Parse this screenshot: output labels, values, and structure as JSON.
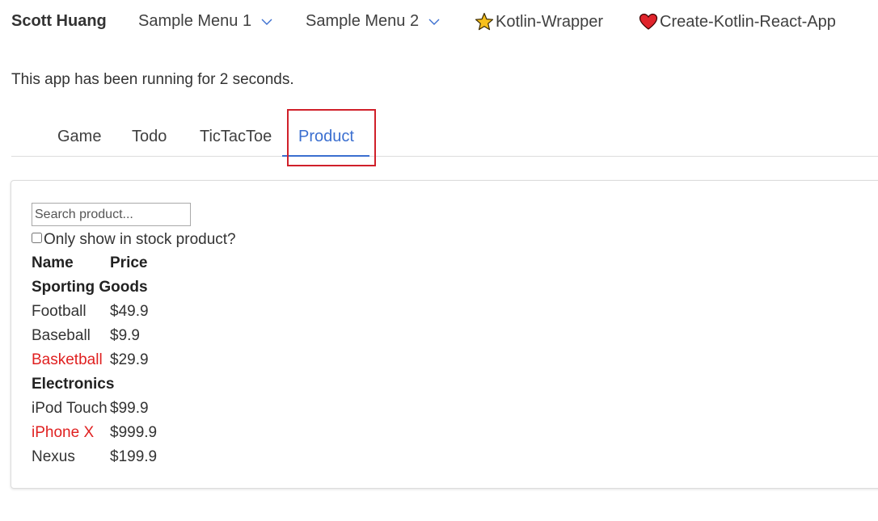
{
  "nav": {
    "brand": "Scott Huang",
    "menu1": "Sample Menu 1",
    "menu2": "Sample Menu 2",
    "kotlin_wrapper": "Kotlin-Wrapper",
    "create_kotlin_react_app": "Create-Kotlin-React-App",
    "icons": {
      "menu1": "chevron-down-icon",
      "menu2": "chevron-down-icon",
      "kotlin_wrapper": "star-icon",
      "create_kotlin_react_app": "heart-icon"
    }
  },
  "running_text": "This app has been running for 2 seconds.",
  "tabs": {
    "items": [
      "Game",
      "Todo",
      "TicTacToe",
      "Product"
    ],
    "active": "Product"
  },
  "product": {
    "search_placeholder": "Search product...",
    "search_value": "",
    "stock_label": "Only show in stock product?",
    "stock_checked": false,
    "headers": {
      "name": "Name",
      "price": "Price"
    },
    "categories": [
      {
        "name": "Sporting Goods",
        "items": [
          {
            "name": "Football",
            "price": "$49.9",
            "stocked": true
          },
          {
            "name": "Baseball",
            "price": "$9.9",
            "stocked": true
          },
          {
            "name": "Basketball",
            "price": "$29.9",
            "stocked": false
          }
        ]
      },
      {
        "name": "Electronics",
        "items": [
          {
            "name": "iPod Touch",
            "price": "$99.9",
            "stocked": true
          },
          {
            "name": "iPhone X",
            "price": "$999.9",
            "stocked": false
          },
          {
            "name": "Nexus",
            "price": "$199.9",
            "stocked": true
          }
        ]
      }
    ]
  },
  "colors": {
    "accent": "#3b6fd0",
    "out_of_stock": "#e02020",
    "highlight_box": "#d0202a"
  }
}
